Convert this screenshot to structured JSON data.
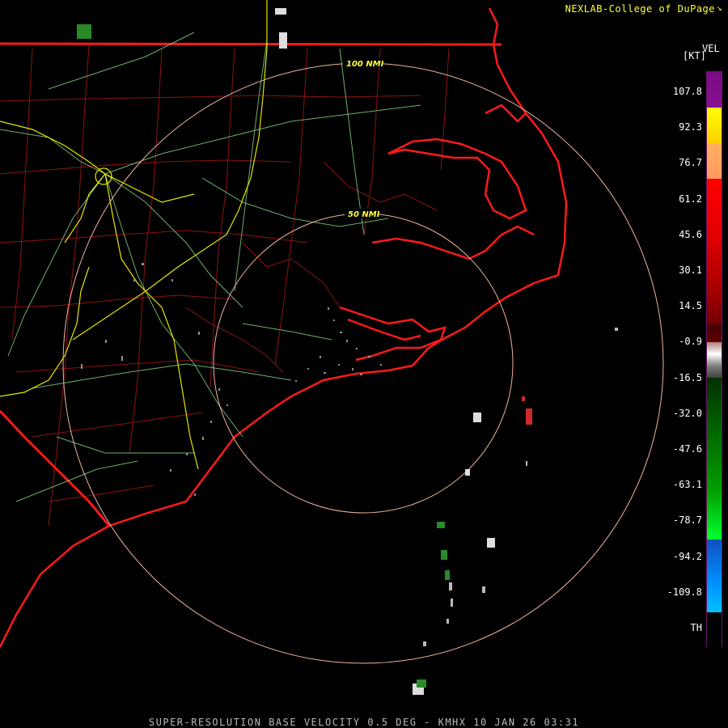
{
  "credit": "NEXLAB-College of DuPage",
  "legend": {
    "product": "VEL",
    "unit": "[KT]",
    "labels": [
      "107.8",
      "92.3",
      "76.7",
      "61.2",
      "45.6",
      "30.1",
      "14.5",
      "-0.9",
      "-16.5",
      "-32.0",
      "-47.6",
      "-63.1",
      "-78.7",
      "-94.2",
      "-109.8",
      "TH"
    ]
  },
  "rings": {
    "inner_label": "50 NMI",
    "outer_label": "100 NMI"
  },
  "footer": "SUPER-RESOLUTION BASE VELOCITY 0.5 DEG - KMHX 10 JAN 26 03:31",
  "colors": {
    "coastline": "#ff1a1a",
    "county": "#b01010",
    "highway": "#7fcf7f",
    "interstate": "#e6e600",
    "ring": "#f0b4a0",
    "label": "#ffff3c"
  }
}
